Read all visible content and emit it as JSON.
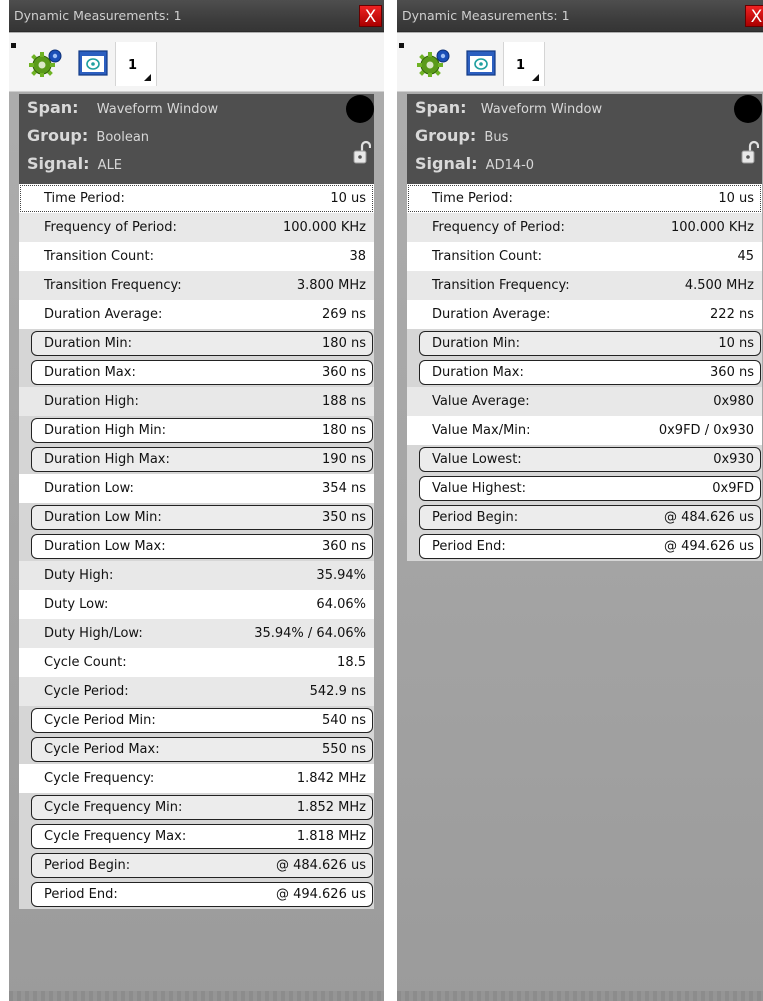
{
  "panels": [
    {
      "title": "Dynamic Measurements: 1",
      "close_label": "X",
      "tab_label": "1",
      "span_label": "Span:",
      "span_value": "Waveform Window",
      "group_label": "Group:",
      "group_value": "Boolean",
      "signal_label": "Signal:",
      "signal_value": "ALE",
      "rows": [
        {
          "label": "Time Period:",
          "value": "10 us",
          "style": "dotted"
        },
        {
          "label": "Frequency of Period:",
          "value": "100.000 KHz",
          "style": "even"
        },
        {
          "label": "Transition Count:",
          "value": "38",
          "style": "odd"
        },
        {
          "label": "Transition Frequency:",
          "value": "3.800 MHz",
          "style": "even"
        },
        {
          "label": "Duration Average:",
          "value": "269 ns",
          "style": "odd"
        },
        {
          "label": "Duration Min:",
          "value": "180 ns",
          "style": "boxed-even"
        },
        {
          "label": "Duration Max:",
          "value": "360 ns",
          "style": "boxed"
        },
        {
          "label": "Duration High:",
          "value": "188 ns",
          "style": "even"
        },
        {
          "label": "Duration High Min:",
          "value": "180 ns",
          "style": "boxed"
        },
        {
          "label": "Duration High Max:",
          "value": "190 ns",
          "style": "boxed-even"
        },
        {
          "label": "Duration Low:",
          "value": "354 ns",
          "style": "odd"
        },
        {
          "label": "Duration Low Min:",
          "value": "350 ns",
          "style": "boxed-even"
        },
        {
          "label": "Duration Low Max:",
          "value": "360 ns",
          "style": "boxed"
        },
        {
          "label": "Duty High:",
          "value": "35.94%",
          "style": "even"
        },
        {
          "label": "Duty Low:",
          "value": "64.06%",
          "style": "odd"
        },
        {
          "label": "Duty High/Low:",
          "value": "35.94% / 64.06%",
          "style": "even"
        },
        {
          "label": "Cycle Count:",
          "value": "18.5",
          "style": "odd"
        },
        {
          "label": "Cycle Period:",
          "value": "542.9 ns",
          "style": "even"
        },
        {
          "label": "Cycle Period Min:",
          "value": "540 ns",
          "style": "boxed"
        },
        {
          "label": "Cycle Period Max:",
          "value": "550 ns",
          "style": "boxed-even"
        },
        {
          "label": "Cycle Frequency:",
          "value": "1.842 MHz",
          "style": "odd"
        },
        {
          "label": "Cycle Frequency Min:",
          "value": "1.852 MHz",
          "style": "boxed-even"
        },
        {
          "label": "Cycle Frequency Max:",
          "value": "1.818 MHz",
          "style": "boxed"
        },
        {
          "label": "Period Begin:",
          "value": "@ 484.626 us",
          "style": "boxed-even"
        },
        {
          "label": "Period End:",
          "value": "@ 494.626 us",
          "style": "boxed"
        }
      ]
    },
    {
      "title": "Dynamic Measurements: 1",
      "close_label": "X",
      "tab_label": "1",
      "span_label": "Span:",
      "span_value": "Waveform Window",
      "group_label": "Group:",
      "group_value": "Bus",
      "signal_label": "Signal:",
      "signal_value": "AD14-0",
      "rows": [
        {
          "label": "Time Period:",
          "value": "10 us",
          "style": "dotted"
        },
        {
          "label": "Frequency of Period:",
          "value": "100.000 KHz",
          "style": "even"
        },
        {
          "label": "Transition Count:",
          "value": "45",
          "style": "odd"
        },
        {
          "label": "Transition Frequency:",
          "value": "4.500 MHz",
          "style": "even"
        },
        {
          "label": "Duration Average:",
          "value": "222 ns",
          "style": "odd"
        },
        {
          "label": "Duration Min:",
          "value": "10 ns",
          "style": "boxed-even"
        },
        {
          "label": "Duration Max:",
          "value": "360 ns",
          "style": "boxed"
        },
        {
          "label": "Value Average:",
          "value": "0x980",
          "style": "even"
        },
        {
          "label": "Value Max/Min:",
          "value": "0x9FD / 0x930",
          "style": "odd"
        },
        {
          "label": "Value Lowest:",
          "value": "0x930",
          "style": "boxed-even"
        },
        {
          "label": "Value Highest:",
          "value": "0x9FD",
          "style": "boxed"
        },
        {
          "label": "Period Begin:",
          "value": "@ 484.626 us",
          "style": "boxed-even"
        },
        {
          "label": "Period End:",
          "value": "@ 494.626 us",
          "style": "boxed"
        }
      ]
    }
  ]
}
